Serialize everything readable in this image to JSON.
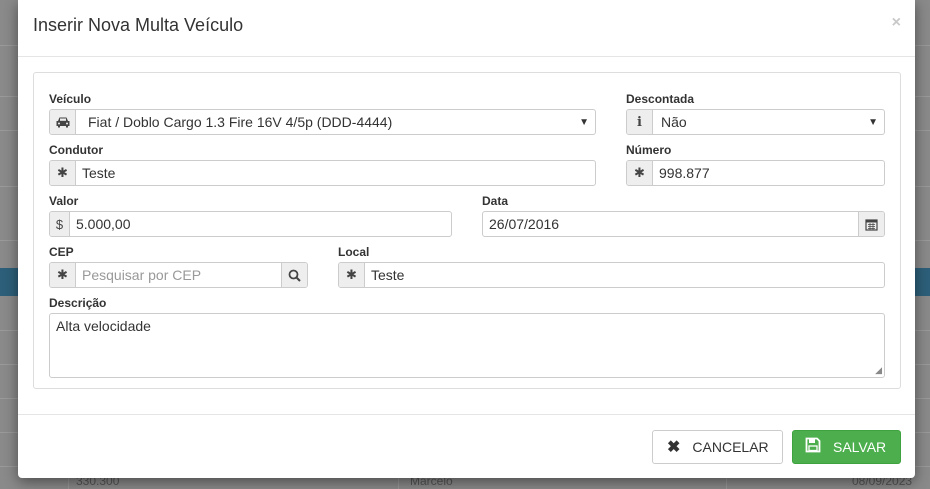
{
  "modal": {
    "title": "Inserir Nova Multa Veículo",
    "close_symbol": "×"
  },
  "form": {
    "veiculo": {
      "label": "Veículo",
      "value": "Fiat / Doblo Cargo 1.3 Fire 16V 4/5p (DDD-4444)",
      "icon": "car-icon"
    },
    "descontada": {
      "label": "Descontada",
      "value": "Não",
      "icon": "info-icon"
    },
    "condutor": {
      "label": "Condutor",
      "value": "Teste",
      "icon": "asterisk-icon"
    },
    "numero": {
      "label": "Número",
      "value": "998.877",
      "icon": "asterisk-icon"
    },
    "valor": {
      "label": "Valor",
      "value": "5.000,00",
      "addon": "$"
    },
    "data": {
      "label": "Data",
      "value": "26/07/2016",
      "icon": "calendar-icon"
    },
    "cep": {
      "label": "CEP",
      "placeholder": "Pesquisar por CEP",
      "icon": "asterisk-icon",
      "search_icon": "search-icon"
    },
    "local": {
      "label": "Local",
      "value": "Teste",
      "icon": "asterisk-icon"
    },
    "descricao": {
      "label": "Descrição",
      "value": "Alta velocidade"
    }
  },
  "footer": {
    "cancel_label": "CANCELAR",
    "save_label": "SALVAR"
  },
  "background": {
    "cell_left": "330.300",
    "cell_mid": "Marcelo",
    "cell_right": "08/09/2023"
  },
  "colors": {
    "save_button": "#4cae4c",
    "selected_row_band": "#2d5f7a",
    "overlay": "#7f7f7f"
  }
}
